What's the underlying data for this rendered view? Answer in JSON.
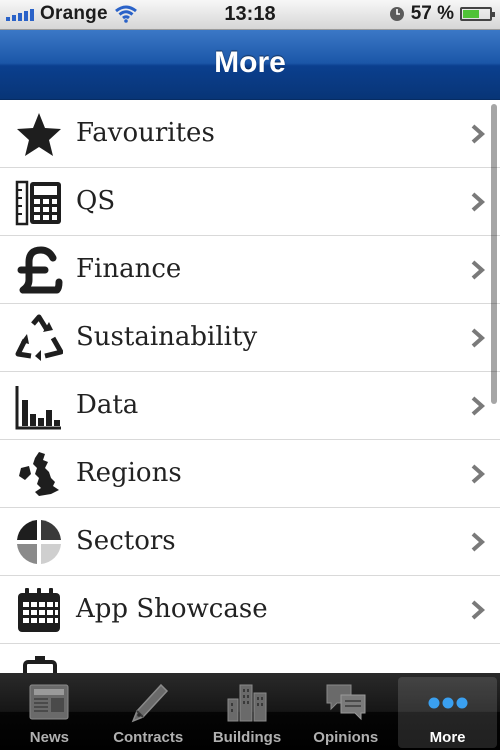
{
  "status_bar": {
    "carrier": "Orange",
    "time": "13:18",
    "battery_percent": "57 %",
    "battery_level": 0.57
  },
  "nav": {
    "title": "More"
  },
  "list": {
    "items": [
      {
        "label": "Favourites",
        "icon": "star-icon"
      },
      {
        "label": "QS",
        "icon": "calculator-icon"
      },
      {
        "label": "Finance",
        "icon": "pound-sign-icon"
      },
      {
        "label": "Sustainability",
        "icon": "recycle-icon"
      },
      {
        "label": "Data",
        "icon": "bar-chart-icon"
      },
      {
        "label": "Regions",
        "icon": "uk-map-icon"
      },
      {
        "label": "Sectors",
        "icon": "pie-chart-icon"
      },
      {
        "label": "App Showcase",
        "icon": "calendar-icon"
      }
    ]
  },
  "tabs": [
    {
      "label": "News",
      "icon": "newspaper-icon"
    },
    {
      "label": "Contracts",
      "icon": "pen-icon"
    },
    {
      "label": "Buildings",
      "icon": "buildings-icon"
    },
    {
      "label": "Opinions",
      "icon": "speech-bubbles-icon"
    },
    {
      "label": "More",
      "icon": "more-dots-icon",
      "active": true
    }
  ],
  "colors": {
    "nav_blue": "#1b56a8",
    "signal_blue": "#2a62c8",
    "battery_green": "#4fc236",
    "more_dots_blue": "#3aa0f0"
  }
}
